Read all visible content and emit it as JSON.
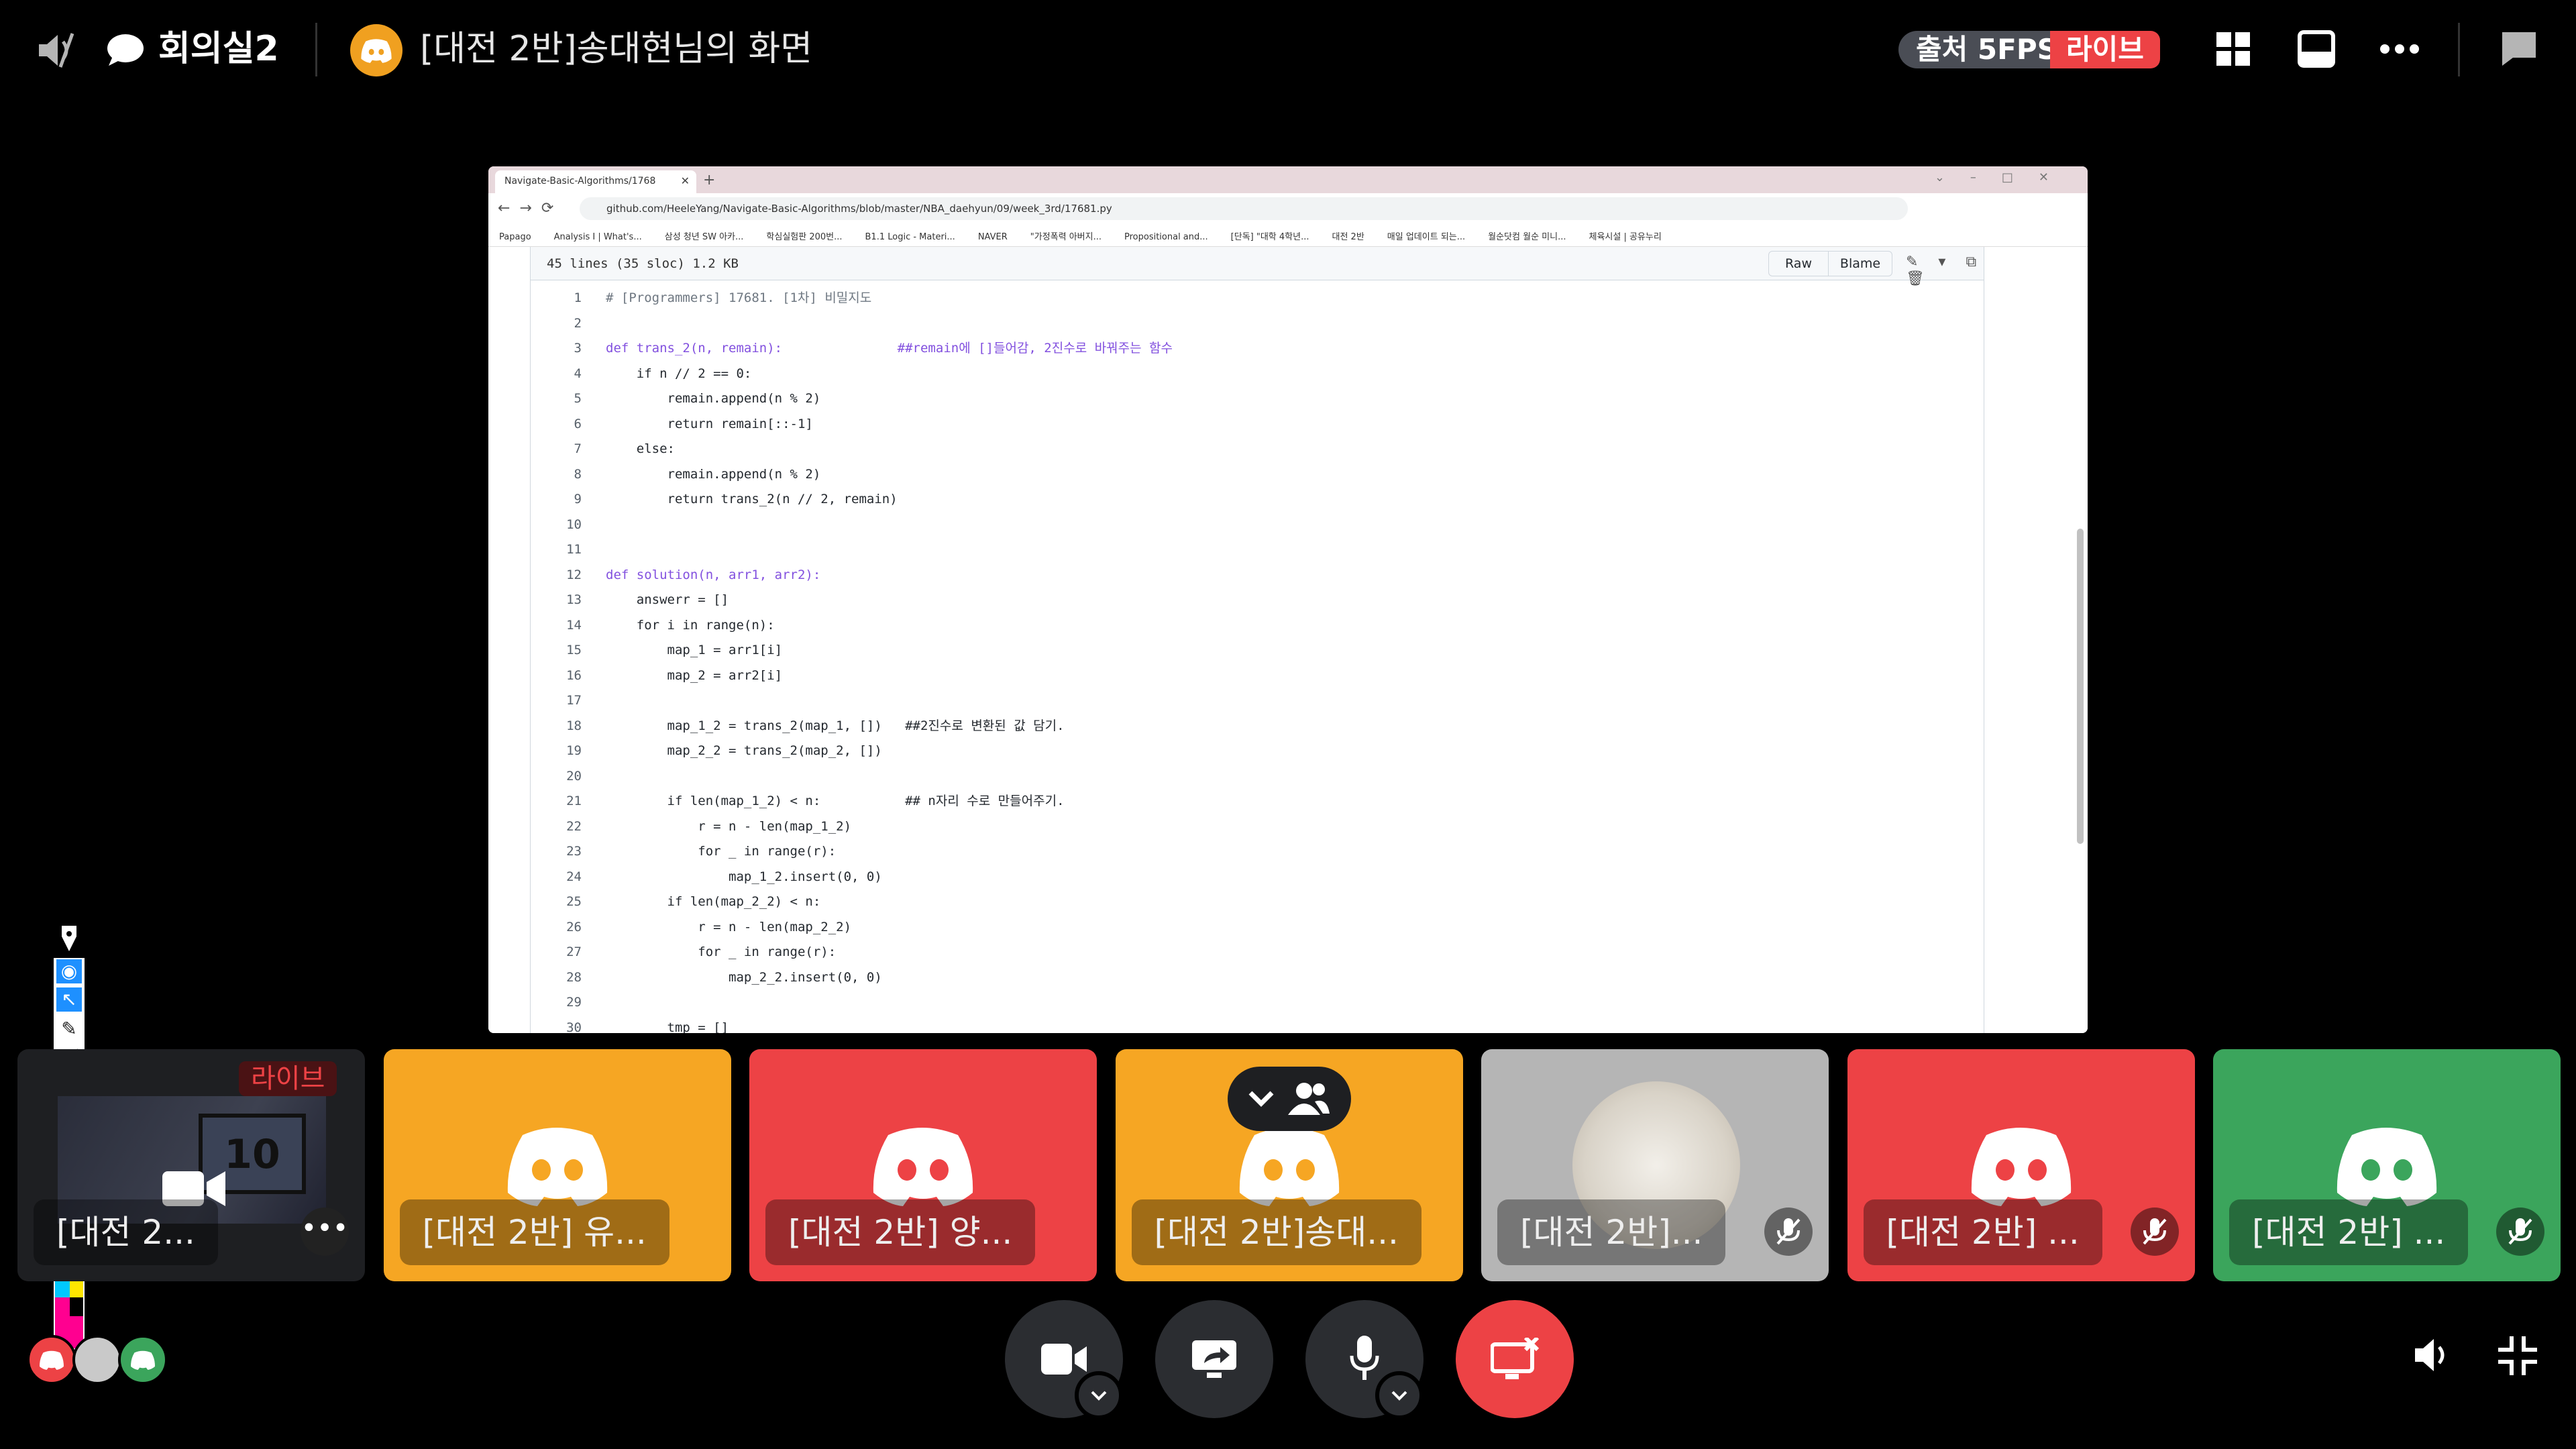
{
  "topbar": {
    "channel_name": "회의실2",
    "stream_title": "[대전 2반]송대현님의 화면",
    "fps_label": "출처 5FPS",
    "live_label": "라이브"
  },
  "browser": {
    "tab_title": "Navigate-Basic-Algorithms/1768",
    "url": "github.com/HeeleYang/Navigate-Basic-Algorithms/blob/master/NBA_daehyun/09/week_3rd/17681.py",
    "bookmarks": [
      "Papago",
      "Analysis I | What's...",
      "삼성 청년 SW 아카...",
      "학심실험판 200번...",
      "B1.1 Logic - Materi...",
      "NAVER",
      "\"가정폭력 아버지...",
      "Propositional and...",
      "[단독] \"대학 4학년...",
      "대전 2반",
      "매일 업데이트 되는...",
      "월순닷컴 월순 미니...",
      "체육시설 | 공유누리"
    ]
  },
  "file": {
    "info": "45 lines (35 sloc)    1.2 KB",
    "raw_label": "Raw",
    "blame_label": "Blame"
  },
  "code_lines": [
    {
      "n": "1",
      "t": "# [Programmers] 17681. [1차] 비밀지도",
      "c": "comment"
    },
    {
      "n": "2",
      "t": "",
      "c": "plain"
    },
    {
      "n": "3",
      "t": "def trans_2(n, remain):               ##remain에 []들어감, 2진수로 바꿔주는 함수",
      "c": "def"
    },
    {
      "n": "4",
      "t": "    if n // 2 == 0:",
      "c": "plain"
    },
    {
      "n": "5",
      "t": "        remain.append(n % 2)",
      "c": "plain"
    },
    {
      "n": "6",
      "t": "        return remain[::-1]",
      "c": "plain"
    },
    {
      "n": "7",
      "t": "    else:",
      "c": "plain"
    },
    {
      "n": "8",
      "t": "        remain.append(n % 2)",
      "c": "plain"
    },
    {
      "n": "9",
      "t": "        return trans_2(n // 2, remain)",
      "c": "plain"
    },
    {
      "n": "10",
      "t": "",
      "c": "plain"
    },
    {
      "n": "11",
      "t": "",
      "c": "plain"
    },
    {
      "n": "12",
      "t": "def solution(n, arr1, arr2):",
      "c": "def"
    },
    {
      "n": "13",
      "t": "    answerr = []",
      "c": "plain"
    },
    {
      "n": "14",
      "t": "    for i in range(n):",
      "c": "plain"
    },
    {
      "n": "15",
      "t": "        map_1 = arr1[i]",
      "c": "plain"
    },
    {
      "n": "16",
      "t": "        map_2 = arr2[i]",
      "c": "plain"
    },
    {
      "n": "17",
      "t": "",
      "c": "plain"
    },
    {
      "n": "18",
      "t": "        map_1_2 = trans_2(map_1, [])   ##2진수로 변환된 값 담기.",
      "c": "plain"
    },
    {
      "n": "19",
      "t": "        map_2_2 = trans_2(map_2, [])",
      "c": "plain"
    },
    {
      "n": "20",
      "t": "",
      "c": "plain"
    },
    {
      "n": "21",
      "t": "        if len(map_1_2) < n:           ## n자리 수로 만들어주기.",
      "c": "plain"
    },
    {
      "n": "22",
      "t": "            r = n - len(map_1_2)",
      "c": "plain"
    },
    {
      "n": "23",
      "t": "            for _ in range(r):",
      "c": "plain"
    },
    {
      "n": "24",
      "t": "                map_1_2.insert(0, 0)",
      "c": "plain"
    },
    {
      "n": "25",
      "t": "        if len(map_2_2) < n:",
      "c": "plain"
    },
    {
      "n": "26",
      "t": "            r = n - len(map_2_2)",
      "c": "plain"
    },
    {
      "n": "27",
      "t": "            for _ in range(r):",
      "c": "plain"
    },
    {
      "n": "28",
      "t": "                map_2_2.insert(0, 0)",
      "c": "plain"
    },
    {
      "n": "29",
      "t": "",
      "c": "plain"
    },
    {
      "n": "30",
      "t": "        tmp = []",
      "c": "plain"
    }
  ],
  "tiles": [
    {
      "name": "[대전 2...",
      "bg": "#1e1f22",
      "kind": "video",
      "live": "라이브"
    },
    {
      "name": "[대전 2반] 유...",
      "bg": "#f6a623",
      "kind": "logo"
    },
    {
      "name": "[대전 2반] 양...",
      "bg": "#ed4245",
      "kind": "logo"
    },
    {
      "name": "[대전 2반]송대...",
      "bg": "#f6a623",
      "kind": "logo"
    },
    {
      "name": "[대전 2반]...",
      "bg": "#b5b5b5",
      "kind": "photo",
      "muted": true
    },
    {
      "name": "[대전 2반] ...",
      "bg": "#ed4245",
      "kind": "logo",
      "muted": true
    },
    {
      "name": "[대전 2반] ...",
      "bg": "#3ba55c",
      "kind": "logo",
      "muted": true
    }
  ],
  "colors": {
    "accent_red": "#ed4245",
    "accent_orange": "#f6a623",
    "accent_green": "#3ba55c",
    "control_dark": "#2b2d31"
  },
  "icons": {
    "top_left": [
      "volume-muted-icon",
      "chat-bubble-icon",
      "discord-avatar-icon"
    ],
    "top_right": [
      "grid-layout-icon",
      "popout-icon",
      "more-options-icon",
      "chat-icon"
    ],
    "controls": [
      "camera-icon",
      "screen-share-icon",
      "microphone-icon",
      "stop-stream-icon"
    ],
    "bottom_right": [
      "volume-icon",
      "exit-fullscreen-icon"
    ]
  }
}
